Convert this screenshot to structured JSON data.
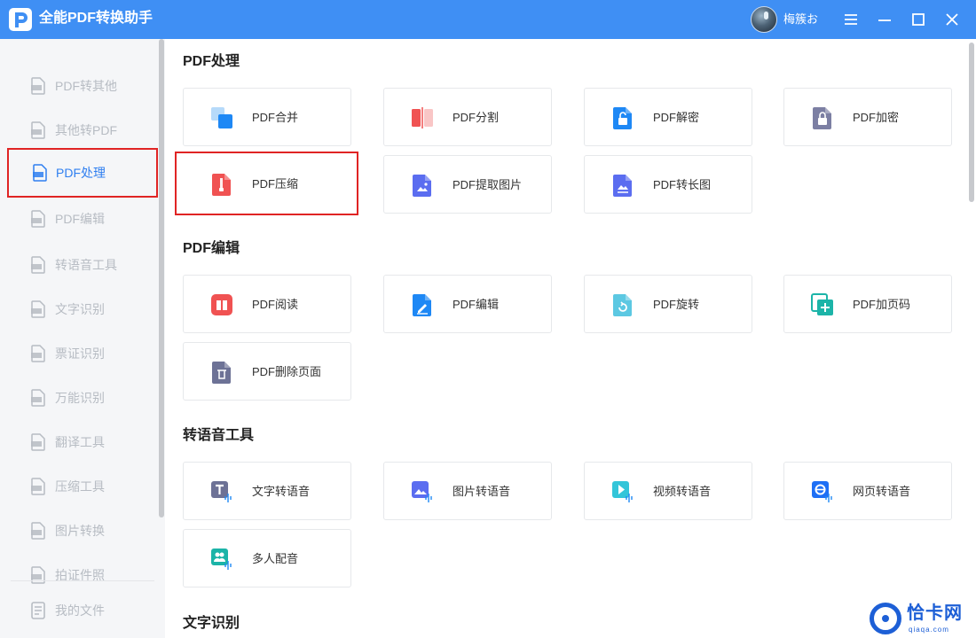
{
  "app": {
    "title": "全能PDF转换助手",
    "logo_icon": "pdf-app-logo"
  },
  "user": {
    "name": "梅簇お"
  },
  "window_controls": [
    "menu-icon",
    "minimize-icon",
    "maximize-icon",
    "close-icon"
  ],
  "colors": {
    "titlebar": "#3f8ff4",
    "accent": "#2f7ff0",
    "highlight_border": "#e02424"
  },
  "sidebar": {
    "items": [
      {
        "label": "PDF转其他",
        "icon": "pdf-to-other-icon"
      },
      {
        "label": "其他转PDF",
        "icon": "other-to-pdf-icon"
      },
      {
        "label": "PDF处理",
        "icon": "pdf-process-icon",
        "active": true
      },
      {
        "label": "PDF编辑",
        "icon": "pdf-edit-icon"
      },
      {
        "label": "转语音工具",
        "icon": "audio-tool-icon"
      },
      {
        "label": "文字识别",
        "icon": "text-ocr-icon"
      },
      {
        "label": "票证识别",
        "icon": "ticket-ocr-icon"
      },
      {
        "label": "万能识别",
        "icon": "universal-ocr-icon"
      },
      {
        "label": "翻译工具",
        "icon": "translate-icon"
      },
      {
        "label": "压缩工具",
        "icon": "compress-tool-icon"
      },
      {
        "label": "图片转换",
        "icon": "image-convert-icon"
      },
      {
        "label": "拍证件照",
        "icon": "id-photo-icon"
      }
    ],
    "my_files": {
      "label": "我的文件",
      "icon": "my-files-icon"
    }
  },
  "sections": [
    {
      "title": "PDF处理",
      "cards": [
        {
          "label": "PDF合并",
          "icon": "pdf-merge-icon"
        },
        {
          "label": "PDF分割",
          "icon": "pdf-split-icon"
        },
        {
          "label": "PDF解密",
          "icon": "pdf-decrypt-icon"
        },
        {
          "label": "PDF加密",
          "icon": "pdf-encrypt-icon"
        },
        {
          "label": "PDF压缩",
          "icon": "pdf-compress-icon",
          "highlighted": true
        },
        {
          "label": "PDF提取图片",
          "icon": "pdf-extract-image-icon"
        },
        {
          "label": "PDF转长图",
          "icon": "pdf-to-long-image-icon"
        }
      ]
    },
    {
      "title": "PDF编辑",
      "cards": [
        {
          "label": "PDF阅读",
          "icon": "pdf-read-icon"
        },
        {
          "label": "PDF编辑",
          "icon": "pdf-edit-card-icon"
        },
        {
          "label": "PDF旋转",
          "icon": "pdf-rotate-icon"
        },
        {
          "label": "PDF加页码",
          "icon": "pdf-page-number-icon"
        },
        {
          "label": "PDF删除页面",
          "icon": "pdf-delete-page-icon"
        }
      ]
    },
    {
      "title": "转语音工具",
      "cards": [
        {
          "label": "文字转语音",
          "icon": "text-to-speech-icon"
        },
        {
          "label": "图片转语音",
          "icon": "image-to-speech-icon"
        },
        {
          "label": "视频转语音",
          "icon": "video-to-speech-icon"
        },
        {
          "label": "网页转语音",
          "icon": "webpage-to-speech-icon"
        },
        {
          "label": "多人配音",
          "icon": "multi-voice-icon"
        }
      ]
    },
    {
      "title": "文字识别",
      "cards": []
    }
  ],
  "watermark": {
    "text": "恰卡网",
    "sub": "qiaqa.com"
  }
}
